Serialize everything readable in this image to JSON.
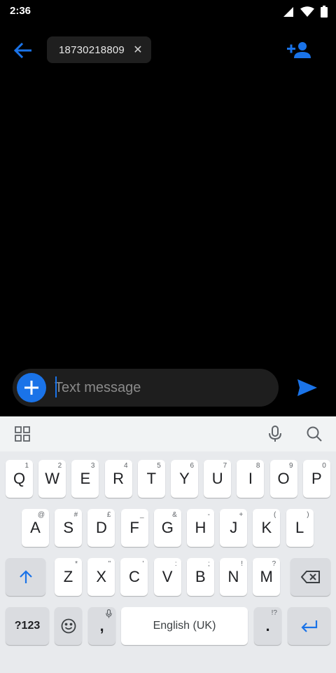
{
  "status_bar": {
    "time": "2:36"
  },
  "conversation": {
    "recipient": "18730218809",
    "remove_icon": "✕"
  },
  "compose": {
    "placeholder": "Text message"
  },
  "keyboard": {
    "row1": [
      {
        "label": "Q",
        "hint": "1"
      },
      {
        "label": "W",
        "hint": "2"
      },
      {
        "label": "E",
        "hint": "3"
      },
      {
        "label": "R",
        "hint": "4"
      },
      {
        "label": "T",
        "hint": "5"
      },
      {
        "label": "Y",
        "hint": "6"
      },
      {
        "label": "U",
        "hint": "7"
      },
      {
        "label": "I",
        "hint": "8"
      },
      {
        "label": "O",
        "hint": "9"
      },
      {
        "label": "P",
        "hint": "0"
      }
    ],
    "row2": [
      {
        "label": "A",
        "hint": "@"
      },
      {
        "label": "S",
        "hint": "#"
      },
      {
        "label": "D",
        "hint": "£"
      },
      {
        "label": "F",
        "hint": "_"
      },
      {
        "label": "G",
        "hint": "&"
      },
      {
        "label": "H",
        "hint": "-"
      },
      {
        "label": "J",
        "hint": "+"
      },
      {
        "label": "K",
        "hint": "("
      },
      {
        "label": "L",
        "hint": ")"
      }
    ],
    "row3": [
      {
        "label": "Z",
        "hint": "*"
      },
      {
        "label": "X",
        "hint": "\""
      },
      {
        "label": "C",
        "hint": "'"
      },
      {
        "label": "V",
        "hint": ":"
      },
      {
        "label": "B",
        "hint": ";"
      },
      {
        "label": "N",
        "hint": "!"
      },
      {
        "label": "M",
        "hint": "?"
      }
    ],
    "symbols_label": "?123",
    "comma_label": ",",
    "space_label": "English (UK)",
    "period_label": ".",
    "period_hint": "!?"
  }
}
